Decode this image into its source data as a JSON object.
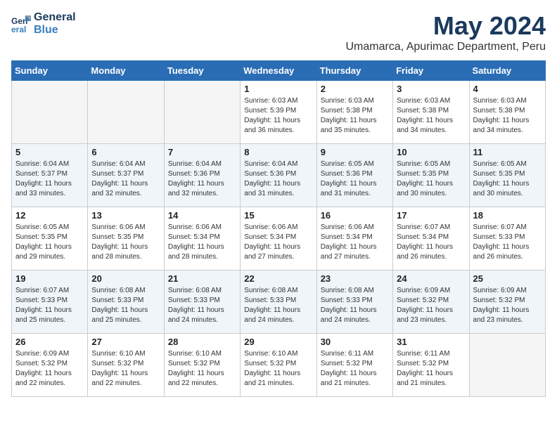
{
  "logo": {
    "line1": "General",
    "line2": "Blue"
  },
  "title": "May 2024",
  "location": "Umamarca, Apurimac Department, Peru",
  "days_of_week": [
    "Sunday",
    "Monday",
    "Tuesday",
    "Wednesday",
    "Thursday",
    "Friday",
    "Saturday"
  ],
  "weeks": [
    [
      {
        "day": "",
        "info": ""
      },
      {
        "day": "",
        "info": ""
      },
      {
        "day": "",
        "info": ""
      },
      {
        "day": "1",
        "info": "Sunrise: 6:03 AM\nSunset: 5:39 PM\nDaylight: 11 hours\nand 36 minutes."
      },
      {
        "day": "2",
        "info": "Sunrise: 6:03 AM\nSunset: 5:38 PM\nDaylight: 11 hours\nand 35 minutes."
      },
      {
        "day": "3",
        "info": "Sunrise: 6:03 AM\nSunset: 5:38 PM\nDaylight: 11 hours\nand 34 minutes."
      },
      {
        "day": "4",
        "info": "Sunrise: 6:03 AM\nSunset: 5:38 PM\nDaylight: 11 hours\nand 34 minutes."
      }
    ],
    [
      {
        "day": "5",
        "info": "Sunrise: 6:04 AM\nSunset: 5:37 PM\nDaylight: 11 hours\nand 33 minutes."
      },
      {
        "day": "6",
        "info": "Sunrise: 6:04 AM\nSunset: 5:37 PM\nDaylight: 11 hours\nand 32 minutes."
      },
      {
        "day": "7",
        "info": "Sunrise: 6:04 AM\nSunset: 5:36 PM\nDaylight: 11 hours\nand 32 minutes."
      },
      {
        "day": "8",
        "info": "Sunrise: 6:04 AM\nSunset: 5:36 PM\nDaylight: 11 hours\nand 31 minutes."
      },
      {
        "day": "9",
        "info": "Sunrise: 6:05 AM\nSunset: 5:36 PM\nDaylight: 11 hours\nand 31 minutes."
      },
      {
        "day": "10",
        "info": "Sunrise: 6:05 AM\nSunset: 5:35 PM\nDaylight: 11 hours\nand 30 minutes."
      },
      {
        "day": "11",
        "info": "Sunrise: 6:05 AM\nSunset: 5:35 PM\nDaylight: 11 hours\nand 30 minutes."
      }
    ],
    [
      {
        "day": "12",
        "info": "Sunrise: 6:05 AM\nSunset: 5:35 PM\nDaylight: 11 hours\nand 29 minutes."
      },
      {
        "day": "13",
        "info": "Sunrise: 6:06 AM\nSunset: 5:35 PM\nDaylight: 11 hours\nand 28 minutes."
      },
      {
        "day": "14",
        "info": "Sunrise: 6:06 AM\nSunset: 5:34 PM\nDaylight: 11 hours\nand 28 minutes."
      },
      {
        "day": "15",
        "info": "Sunrise: 6:06 AM\nSunset: 5:34 PM\nDaylight: 11 hours\nand 27 minutes."
      },
      {
        "day": "16",
        "info": "Sunrise: 6:06 AM\nSunset: 5:34 PM\nDaylight: 11 hours\nand 27 minutes."
      },
      {
        "day": "17",
        "info": "Sunrise: 6:07 AM\nSunset: 5:34 PM\nDaylight: 11 hours\nand 26 minutes."
      },
      {
        "day": "18",
        "info": "Sunrise: 6:07 AM\nSunset: 5:33 PM\nDaylight: 11 hours\nand 26 minutes."
      }
    ],
    [
      {
        "day": "19",
        "info": "Sunrise: 6:07 AM\nSunset: 5:33 PM\nDaylight: 11 hours\nand 25 minutes."
      },
      {
        "day": "20",
        "info": "Sunrise: 6:08 AM\nSunset: 5:33 PM\nDaylight: 11 hours\nand 25 minutes."
      },
      {
        "day": "21",
        "info": "Sunrise: 6:08 AM\nSunset: 5:33 PM\nDaylight: 11 hours\nand 24 minutes."
      },
      {
        "day": "22",
        "info": "Sunrise: 6:08 AM\nSunset: 5:33 PM\nDaylight: 11 hours\nand 24 minutes."
      },
      {
        "day": "23",
        "info": "Sunrise: 6:08 AM\nSunset: 5:33 PM\nDaylight: 11 hours\nand 24 minutes."
      },
      {
        "day": "24",
        "info": "Sunrise: 6:09 AM\nSunset: 5:32 PM\nDaylight: 11 hours\nand 23 minutes."
      },
      {
        "day": "25",
        "info": "Sunrise: 6:09 AM\nSunset: 5:32 PM\nDaylight: 11 hours\nand 23 minutes."
      }
    ],
    [
      {
        "day": "26",
        "info": "Sunrise: 6:09 AM\nSunset: 5:32 PM\nDaylight: 11 hours\nand 22 minutes."
      },
      {
        "day": "27",
        "info": "Sunrise: 6:10 AM\nSunset: 5:32 PM\nDaylight: 11 hours\nand 22 minutes."
      },
      {
        "day": "28",
        "info": "Sunrise: 6:10 AM\nSunset: 5:32 PM\nDaylight: 11 hours\nand 22 minutes."
      },
      {
        "day": "29",
        "info": "Sunrise: 6:10 AM\nSunset: 5:32 PM\nDaylight: 11 hours\nand 21 minutes."
      },
      {
        "day": "30",
        "info": "Sunrise: 6:11 AM\nSunset: 5:32 PM\nDaylight: 11 hours\nand 21 minutes."
      },
      {
        "day": "31",
        "info": "Sunrise: 6:11 AM\nSunset: 5:32 PM\nDaylight: 11 hours\nand 21 minutes."
      },
      {
        "day": "",
        "info": ""
      }
    ]
  ]
}
